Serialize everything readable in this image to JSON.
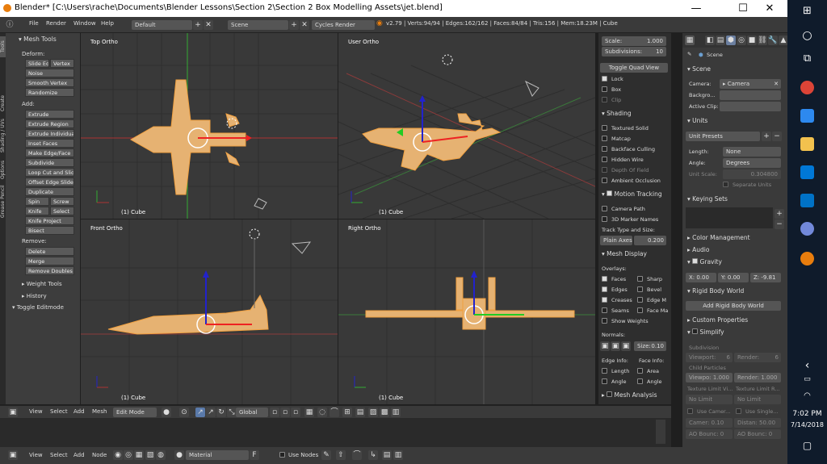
{
  "window": {
    "title": "Blender* [C:\\Users\\rache\\Documents\\Blender Lessons\\Section 2\\Section 2 Box Modelling Assets\\jet.blend]",
    "minimize": "—",
    "maximize": "☐",
    "close": "✕"
  },
  "infobar": {
    "menus": [
      "File",
      "Render",
      "Window",
      "Help"
    ],
    "layout": "Default",
    "scene": "Scene",
    "engine": "Cycles Render",
    "stats": "v2.79 | Verts:94/94 | Edges:162/162 | Faces:84/84 | Tris:156 | Mem:18.23M | Cube"
  },
  "toolshelf": {
    "tabs": [
      "Tools",
      "Create",
      "Shading / UVs",
      "Options",
      "Grease Pencil"
    ],
    "header": "Mesh Tools",
    "deform_label": "Deform:",
    "deform": [
      [
        "Slide Ed",
        "Vertex"
      ],
      [
        "Noise"
      ],
      [
        "Smooth Vertex"
      ],
      [
        "Randomize"
      ]
    ],
    "add_label": "Add:",
    "add": [
      [
        "Extrude"
      ],
      [
        "Extrude Region"
      ],
      [
        "Extrude Individual"
      ],
      [
        "Inset Faces"
      ],
      [
        "Make Edge/Face"
      ],
      [
        "Subdivide"
      ],
      [
        "Loop Cut and Slide"
      ],
      [
        "Offset Edge Slide"
      ],
      [
        "Duplicate"
      ],
      [
        "Spin",
        "Screw"
      ],
      [
        "Knife",
        "Select"
      ],
      [
        "Knife Project"
      ],
      [
        "Bisect"
      ]
    ],
    "remove_label": "Remove:",
    "remove": [
      [
        "Delete"
      ],
      [
        "Merge"
      ],
      [
        "Remove Doubles"
      ]
    ],
    "weight_tools": "Weight Tools",
    "history": "History",
    "toggle_editmode": "Toggle Editmode"
  },
  "viewports": {
    "top": {
      "title": "Top Ortho",
      "foot": "(1) Cube"
    },
    "user": {
      "title": "User Ortho",
      "foot": "(1) Cube"
    },
    "front": {
      "title": "Front Ortho",
      "foot": "(1) Cube"
    },
    "right": {
      "title": "Right Ortho",
      "foot": "(1) Cube"
    }
  },
  "props": {
    "scale_label": "Scale:",
    "scale_value": "1.000",
    "subdiv_label": "Subdivisions:",
    "subdiv_value": "10",
    "toggle_quad": "Toggle Quad View",
    "lock": "Lock",
    "box": "Box",
    "clip": "Clip",
    "shading": "Shading",
    "textured_solid": "Textured Solid",
    "matcap": "Matcap",
    "backface": "Backface Culling",
    "hidden_wire": "Hidden Wire",
    "depth_of_field": "Depth Of Field",
    "ambient_occ": "Ambient Occlusion",
    "motion_tracking": "Motion Tracking",
    "camera_path": "Camera Path",
    "marker_names": "3D Marker Names",
    "track_type_label": "Track Type and Size:",
    "track_type": "Plain Axes",
    "track_size": "0.200",
    "mesh_display": "Mesh Display",
    "overlays": "Overlays:",
    "faces": "Faces",
    "sharp": "Sharp",
    "edges": "Edges",
    "bevel": "Bevel",
    "creases": "Creases",
    "edge_m": "Edge M",
    "seams": "Seams",
    "face_ma": "Face Ma",
    "show_weights": "Show Weights",
    "normals": "Normals:",
    "size_label": "Size:",
    "size_value": "0.10",
    "edge_info": "Edge Info:",
    "face_info": "Face Info:",
    "length": "Length",
    "area": "Area",
    "angle": "Angle",
    "angle2": "Angle",
    "mesh_analysis": "Mesh Analysis"
  },
  "sidebar": {
    "scene_label": "Scene",
    "scene_section": "Scene",
    "camera_label": "Camera:",
    "camera_value": "Camera",
    "background_label": "Backgro...",
    "active_clip_label": "Active Clip:",
    "units": "Units",
    "unit_presets": "Unit Presets",
    "length_label": "Length:",
    "length_value": "None",
    "angle_label": "Angle:",
    "angle_value": "Degrees",
    "unit_scale_label": "Unit Scale:",
    "unit_scale_value": "0.304800",
    "separate_units": "Separate Units",
    "keying_sets": "Keying Sets",
    "color_mgmt": "Color Management",
    "audio": "Audio",
    "gravity": "Gravity",
    "gx": "X: 0.00",
    "gy": "Y: 0.00",
    "gz": "Z: -9.81",
    "rigid_world": "Rigid Body World",
    "add_rigid": "Add Rigid Body World",
    "custom_props": "Custom Properties",
    "simplify": "Simplify",
    "subdivision": "Subdivision",
    "viewport": "Viewport:",
    "viewport_val": "6",
    "render": "Render:",
    "render_val": "6",
    "child_particles": "Child Particles",
    "viewp_val": "Viewpo: 1.000",
    "render_child": "Render: 1.000",
    "tex_limit_v": "Texture Limit Vi...",
    "tex_limit_r": "Texture Limit R...",
    "no_limit": "No Limit",
    "no_limit2": "No Limit",
    "use_camera": "Use Camer...",
    "use_single": "Use Single...",
    "camer_val": "Camer: 0.10",
    "distan_val": "Distan: 50.00",
    "ao_bounc": "AO Bounc: 0",
    "ao_bounc2": "AO Bounc: 0"
  },
  "vpheader": {
    "view": "View",
    "select": "Select",
    "add": "Add",
    "mesh": "Mesh",
    "mode": "Edit Mode",
    "orientation": "Global"
  },
  "tlheader": {
    "view": "View",
    "select": "Select",
    "add": "Add",
    "node": "Node",
    "material": "Material",
    "use_nodes": "Use Nodes"
  },
  "taskbar": {
    "time": "7:02 PM",
    "date": "7/14/2018",
    "chevron": "‹"
  },
  "colors": {
    "accent": "#e8a04a",
    "mesh": "#e6b272",
    "bg": "#393939"
  }
}
